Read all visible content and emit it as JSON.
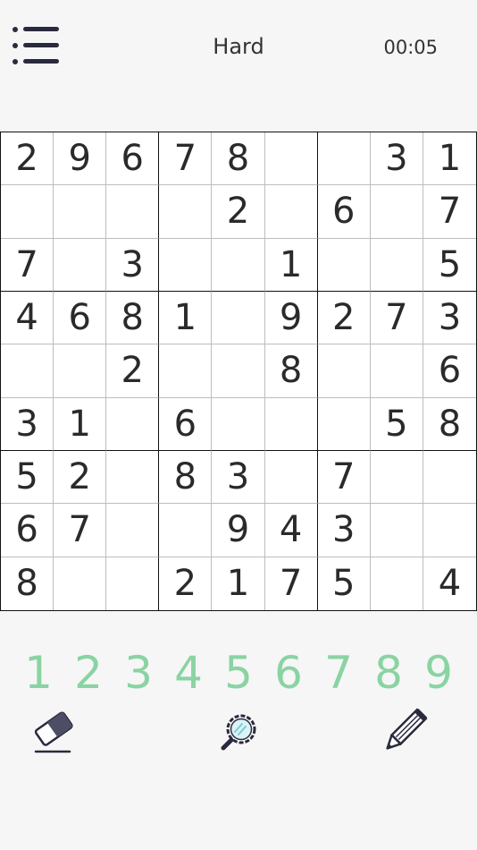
{
  "header": {
    "difficulty": "Hard",
    "timer": "00:05",
    "menu_icon": "menu-list-icon"
  },
  "board": [
    [
      "2",
      "9",
      "6",
      "7",
      "8",
      "",
      "",
      "3",
      "1"
    ],
    [
      "",
      "",
      "",
      "",
      "2",
      "",
      "6",
      "",
      "7"
    ],
    [
      "7",
      "",
      "3",
      "",
      "",
      "1",
      "",
      "",
      "5"
    ],
    [
      "4",
      "6",
      "8",
      "1",
      "",
      "9",
      "2",
      "7",
      "3"
    ],
    [
      "",
      "",
      "2",
      "",
      "",
      "8",
      "",
      "",
      "6"
    ],
    [
      "3",
      "1",
      "",
      "6",
      "",
      "",
      "",
      "5",
      "8"
    ],
    [
      "5",
      "2",
      "",
      "8",
      "3",
      "",
      "7",
      "",
      ""
    ],
    [
      "6",
      "7",
      "",
      "",
      "9",
      "4",
      "3",
      "",
      ""
    ],
    [
      "8",
      "",
      "",
      "2",
      "1",
      "7",
      "5",
      "",
      "4"
    ]
  ],
  "numpad": [
    "1",
    "2",
    "3",
    "4",
    "5",
    "6",
    "7",
    "8",
    "9"
  ],
  "tools": {
    "erase_icon": "eraser-icon",
    "hint_icon": "magnifier-icon",
    "notes_icon": "pencil-icon"
  },
  "colors": {
    "numpad": "#8ad3a2",
    "icons": "#2a2a3e",
    "background": "#f6f6f6",
    "board": "#ffffff"
  }
}
